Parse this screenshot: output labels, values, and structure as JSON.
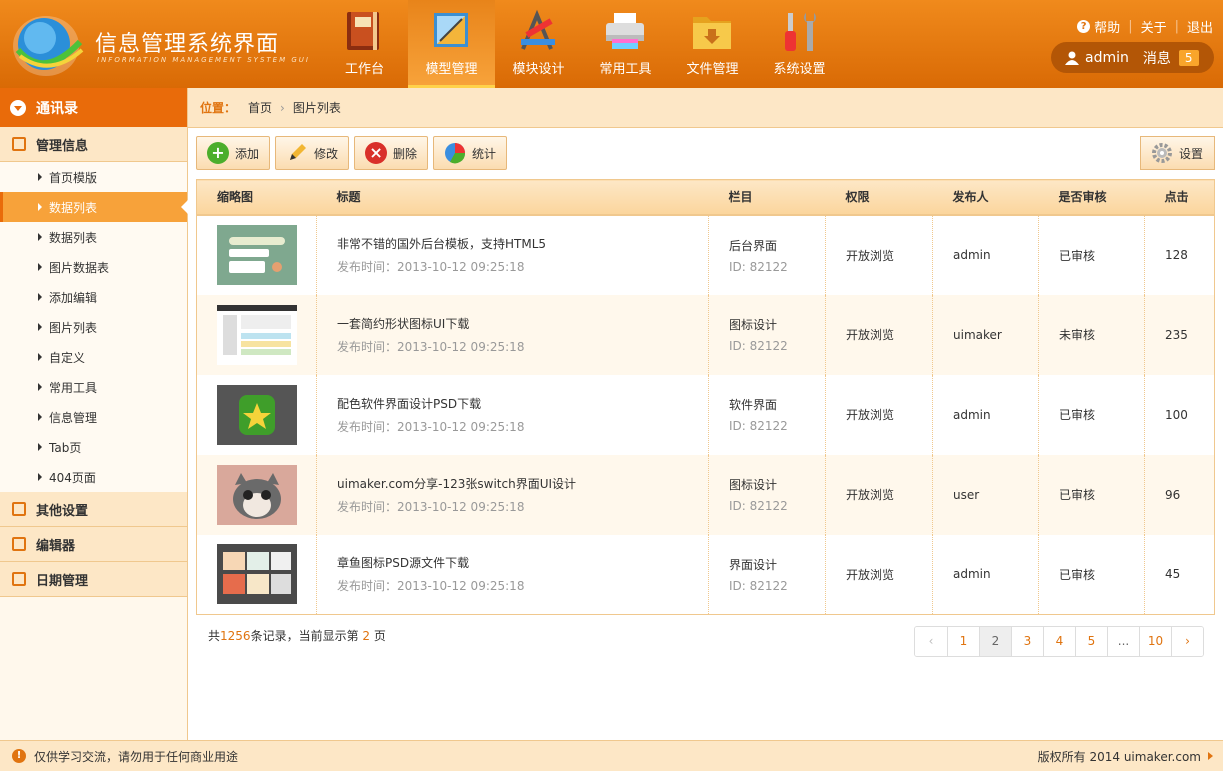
{
  "app": {
    "title": "信息管理系统界面",
    "subtitle": "INFORMATION MANAGEMENT SYSTEM GUI"
  },
  "nav": {
    "items": [
      {
        "label": "工作台",
        "icon": "book-icon"
      },
      {
        "label": "模型管理",
        "icon": "ruler-icon",
        "active": true
      },
      {
        "label": "模块设计",
        "icon": "design-tools-icon"
      },
      {
        "label": "常用工具",
        "icon": "printer-icon"
      },
      {
        "label": "文件管理",
        "icon": "folder-icon"
      },
      {
        "label": "系统设置",
        "icon": "tools-icon"
      }
    ]
  },
  "toplinks": {
    "help": "帮助",
    "about": "关于",
    "logout": "退出"
  },
  "user": {
    "name": "admin",
    "messages_label": "消息",
    "messages_count": "5"
  },
  "sidebar": {
    "header": "通讯录",
    "groups": [
      {
        "label": "管理信息",
        "icon": "list-icon"
      },
      {
        "label": "其他设置",
        "icon": "chat-icon"
      },
      {
        "label": "编辑器",
        "icon": "edit-icon"
      },
      {
        "label": "日期管理",
        "icon": "calendar-icon"
      }
    ],
    "items": [
      {
        "label": "首页模版"
      },
      {
        "label": "数据列表",
        "active": true
      },
      {
        "label": "数据列表"
      },
      {
        "label": "图片数据表"
      },
      {
        "label": "添加编辑"
      },
      {
        "label": "图片列表"
      },
      {
        "label": "自定义"
      },
      {
        "label": "常用工具"
      },
      {
        "label": "信息管理"
      },
      {
        "label": "Tab页"
      },
      {
        "label": "404页面"
      }
    ]
  },
  "breadcrumb": {
    "label": "位置：",
    "home": "首页",
    "current": "图片列表"
  },
  "toolbar": {
    "add": "添加",
    "edit": "修改",
    "delete": "删除",
    "stats": "统计",
    "settings": "设置"
  },
  "table": {
    "headers": [
      "缩略图",
      "标题",
      "栏目",
      "权限",
      "发布人",
      "是否审核",
      "点击"
    ],
    "rows": [
      {
        "title": "非常不错的国外后台模板，支持HTML5",
        "time": "发布时间：2013-10-12 09:25:18",
        "category": "后台界面",
        "id": "ID: 82122",
        "permission": "开放浏览",
        "author": "admin",
        "status": "已审核",
        "clicks": "128"
      },
      {
        "title": "一套简约形状图标UI下载",
        "time": "发布时间：2013-10-12 09:25:18",
        "category": "图标设计",
        "id": "ID: 82122",
        "permission": "开放浏览",
        "author": "uimaker",
        "status": "未审核",
        "clicks": "235"
      },
      {
        "title": "配色软件界面设计PSD下载",
        "time": "发布时间：2013-10-12 09:25:18",
        "category": "软件界面",
        "id": "ID: 82122",
        "permission": "开放浏览",
        "author": "admin",
        "status": "已审核",
        "clicks": "100"
      },
      {
        "title": "uimaker.com分享-123张switch界面UI设计",
        "time": "发布时间：2013-10-12 09:25:18",
        "category": "图标设计",
        "id": "ID: 82122",
        "permission": "开放浏览",
        "author": "user",
        "status": "已审核",
        "clicks": "96"
      },
      {
        "title": "章鱼图标PSD源文件下载",
        "time": "发布时间：2013-10-12 09:25:18",
        "category": "界面设计",
        "id": "ID: 82122",
        "permission": "开放浏览",
        "author": "admin",
        "status": "已审核",
        "clicks": "45"
      }
    ]
  },
  "summary": {
    "prefix": "共",
    "total": "1256",
    "mid": "条记录，当前显示第",
    "page": "2",
    "suffix": "页"
  },
  "pager": {
    "prev": "‹",
    "pages": [
      "1",
      "2",
      "3",
      "4",
      "5",
      "...",
      "10"
    ],
    "current": "2",
    "next": "›"
  },
  "footer": {
    "notice": "仅供学习交流，请勿用于任何商业用途",
    "copyright": "版权所有 2014 uimaker.com"
  },
  "colors": {
    "accent": "#e96b0a",
    "light": "#fde7c6",
    "unapproved": "#e0301e"
  }
}
